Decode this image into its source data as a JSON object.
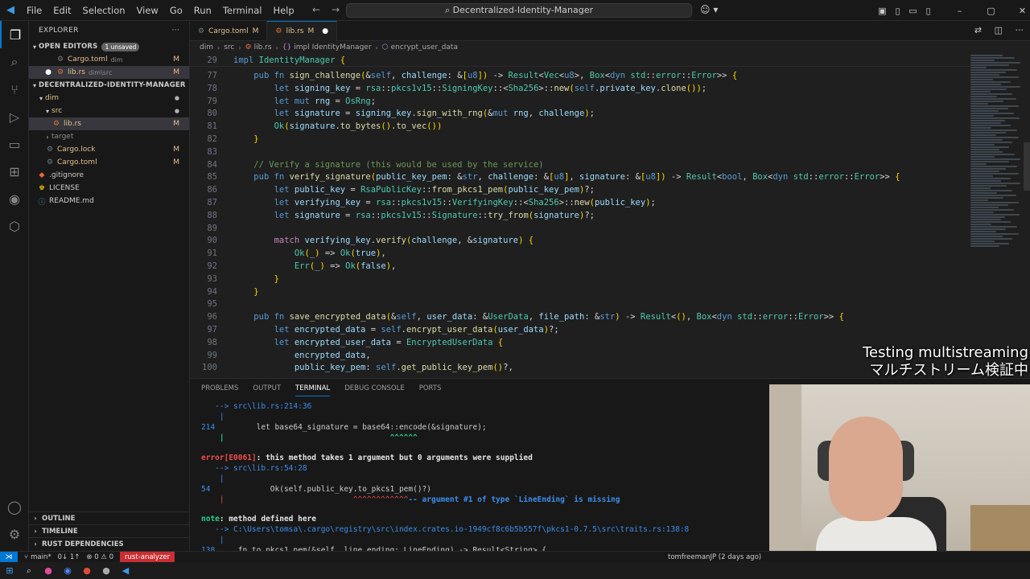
{
  "titlebar": {
    "menu": [
      "File",
      "Edit",
      "Selection",
      "View",
      "Go",
      "Run",
      "Terminal",
      "Help"
    ],
    "search_text": "Decentralized-Identity-Manager"
  },
  "sidebar": {
    "title": "EXPLORER",
    "open_editors_label": "OPEN EDITORS",
    "unsaved_label": "1 unsaved",
    "open_editors": [
      {
        "name": "Cargo.toml",
        "path": "dim",
        "badge": "M"
      },
      {
        "name": "lib.rs",
        "path": "dim\\src",
        "badge": "M"
      }
    ],
    "project_label": "DECENTRALIZED-IDENTITY-MANAGER",
    "tree": [
      {
        "name": "dim",
        "badge": ""
      },
      {
        "name": "src",
        "badge": ""
      },
      {
        "name": "lib.rs",
        "badge": "M"
      },
      {
        "name": "target",
        "badge": ""
      },
      {
        "name": "Cargo.lock",
        "badge": "M"
      },
      {
        "name": "Cargo.toml",
        "badge": "M"
      },
      {
        "name": ".gitignore",
        "badge": ""
      },
      {
        "name": "LICENSE",
        "badge": ""
      },
      {
        "name": "README.md",
        "badge": ""
      }
    ],
    "outline_label": "OUTLINE",
    "timeline_label": "TIMELINE",
    "rust_deps_label": "RUST DEPENDENCIES"
  },
  "tabs": [
    {
      "name": "Cargo.toml",
      "mod": "M",
      "active": false
    },
    {
      "name": "lib.rs",
      "mod": "M",
      "active": true
    }
  ],
  "breadcrumb": [
    "dim",
    "src",
    "lib.rs",
    "impl IdentityManager",
    "encrypt_user_data"
  ],
  "editor": {
    "sticky": {
      "ln": "29",
      "code": "impl IdentityManager {"
    },
    "lines": [
      {
        "ln": "77",
        "code": "    pub fn sign_challenge(&self, challenge: &[u8]) -> Result<Vec<u8>, Box<dyn std::error::Error>> {"
      },
      {
        "ln": "78",
        "code": "        let signing_key = rsa::pkcs1v15::SigningKey::<Sha256>::new(self.private_key.clone());"
      },
      {
        "ln": "79",
        "code": "        let mut rng = OsRng;"
      },
      {
        "ln": "80",
        "code": "        let signature = signing_key.sign_with_rng(&mut rng, challenge);"
      },
      {
        "ln": "81",
        "code": "        Ok(signature.to_bytes().to_vec())"
      },
      {
        "ln": "82",
        "code": "    }"
      },
      {
        "ln": "83",
        "code": ""
      },
      {
        "ln": "84",
        "code": "    // Verify a signature (this would be used by the service)"
      },
      {
        "ln": "85",
        "code": "    pub fn verify_signature(public_key_pem: &str, challenge: &[u8], signature: &[u8]) -> Result<bool, Box<dyn std::error::Error>> {"
      },
      {
        "ln": "86",
        "code": "        let public_key = RsaPublicKey::from_pkcs1_pem(public_key_pem)?;"
      },
      {
        "ln": "87",
        "code": "        let verifying_key = rsa::pkcs1v15::VerifyingKey::<Sha256>::new(public_key);"
      },
      {
        "ln": "88",
        "code": "        let signature = rsa::pkcs1v15::Signature::try_from(signature)?;"
      },
      {
        "ln": "89",
        "code": ""
      },
      {
        "ln": "90",
        "code": "        match verifying_key.verify(challenge, &signature) {"
      },
      {
        "ln": "91",
        "code": "            Ok(_) => Ok(true),"
      },
      {
        "ln": "92",
        "code": "            Err(_) => Ok(false),"
      },
      {
        "ln": "93",
        "code": "        }"
      },
      {
        "ln": "94",
        "code": "    }"
      },
      {
        "ln": "95",
        "code": ""
      },
      {
        "ln": "96",
        "code": "    pub fn save_encrypted_data(&self, user_data: &UserData, file_path: &str) -> Result<(), Box<dyn std::error::Error>> {"
      },
      {
        "ln": "97",
        "code": "        let encrypted_data = self.encrypt_user_data(user_data)?;"
      },
      {
        "ln": "98",
        "code": "        let encrypted_user_data = EncryptedUserData {"
      },
      {
        "ln": "99",
        "code": "            encrypted_data,"
      },
      {
        "ln": "100",
        "code": "            public_key_pem: self.get_public_key_pem()?,"
      }
    ]
  },
  "panel": {
    "tabs": [
      "PROBLEMS",
      "OUTPUT",
      "TERMINAL",
      "DEBUG CONSOLE",
      "PORTS"
    ],
    "active_tab": "TERMINAL",
    "terminal": {
      "l1": "   --> src\\lib.rs:214:36",
      "l2": "    |",
      "l3_num": "214",
      "l3_code": "         let base64_signature = base64::encode(&signature);",
      "l4": "    |                                    ^^^^^^",
      "l5_err": "error[E0061]",
      "l5_msg": ": this method takes 1 argument but 0 arguments were supplied",
      "l6": "   --> src\\lib.rs:54:28",
      "l7": "    |",
      "l8_num": "54",
      "l8_code": "             Ok(self.public_key.to_pkcs1_pem()?)",
      "l9_carets": "    |                            ^^^^^^^^^^^^",
      "l9_msg": "-- argument #1 of type `LineEnding` is missing",
      "l10_note": "note",
      "l10_msg": ": method defined here",
      "l11": "   --> C:\\Users\\tomsa\\.cargo\\registry\\src\\index.crates.io-1949cf8c6b5b557f\\pkcs1-0.7.5\\src\\traits.rs:138:8",
      "l12": "    |",
      "l13_num": "138",
      "l13_code": "     fn to_pkcs1_pem(&self, line_ending: LineEnding) -> Result<String> {"
    }
  },
  "overlay": {
    "line1": "Testing multistreaming",
    "line2": "マルチストリーム検証中"
  },
  "statusbar": {
    "branch": "main*",
    "sync": "0↓ 1↑",
    "problems": "⊗ 0 ⚠ 0",
    "rust_analyzer": "rust-analyzer",
    "blame": "tomfreemanJP (2 days ago)"
  },
  "colors": {
    "accent": "#0078d4",
    "modified": "#e2c08d",
    "error": "#f14c4c",
    "rust_analyzer_bg": "#c72e34"
  }
}
